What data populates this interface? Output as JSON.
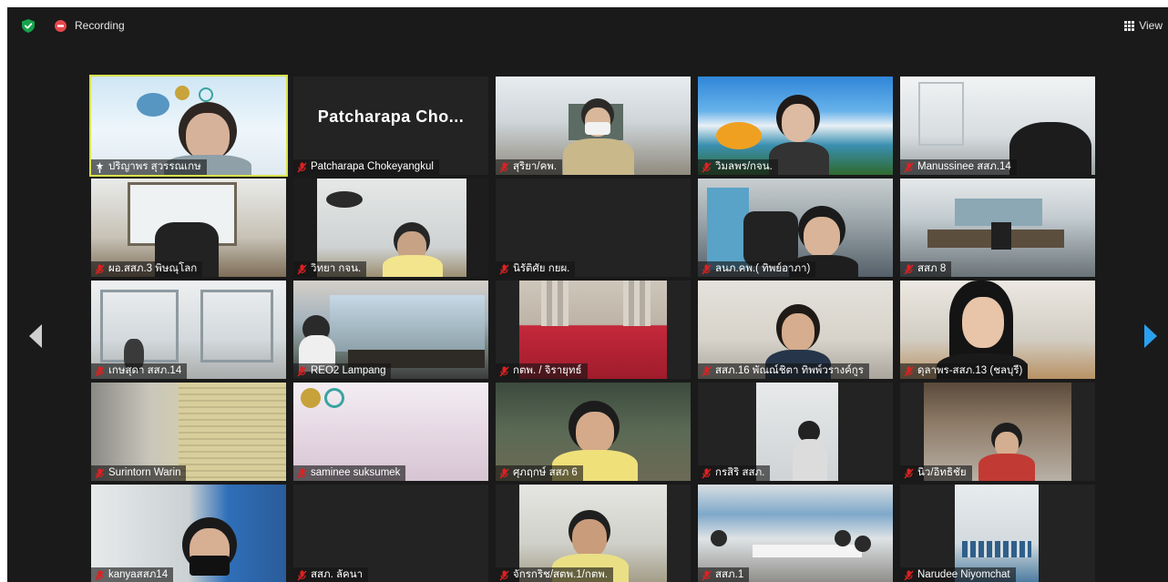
{
  "recording": {
    "label": "Recording"
  },
  "view": {
    "label": "View"
  },
  "gallery": {
    "big_name": "Patcharapa  Cho...",
    "tiles": [
      {
        "name": "ปริญาพร สุวรรณเกษ",
        "muted": false,
        "active": true
      },
      {
        "name": "Patcharapa Chokeyangkul",
        "muted": true
      },
      {
        "name": "สุริยา/คพ.",
        "muted": true
      },
      {
        "name": "วิมลพร/กจน.",
        "muted": true
      },
      {
        "name": "Manussinee สสภ.14",
        "muted": true
      },
      {
        "name": "ผอ.สสภ.3 พิษณุโลก",
        "muted": true
      },
      {
        "name": "วิทยา กจน.",
        "muted": true
      },
      {
        "name": "นิรัติศัย กยผ.",
        "muted": true
      },
      {
        "name": "ลนภ.คพ.( ทิพย์อาภา)",
        "muted": true
      },
      {
        "name": "สสภ 8",
        "muted": true
      },
      {
        "name": "เกษสุดา สสภ.14",
        "muted": true
      },
      {
        "name": "REO2 Lampang",
        "muted": true
      },
      {
        "name": "กตพ. / จิรายุทธ์",
        "muted": true
      },
      {
        "name": "สสภ.16 พัณณ์ชิตา ทิพพ์วรางค์กูร",
        "muted": true
      },
      {
        "name": "ดุลาพร-สสภ.13 (ชลบุรี)",
        "muted": true
      },
      {
        "name": "Surintorn Warin",
        "muted": true
      },
      {
        "name": "saminee suksumek",
        "muted": true
      },
      {
        "name": "ศุภฤกษ์ สสภ 6",
        "muted": true
      },
      {
        "name": "กรสิริ สสภ.",
        "muted": true
      },
      {
        "name": "นิว/อิทธิชัย",
        "muted": true
      },
      {
        "name": "kanyaสสภ14",
        "muted": true
      },
      {
        "name": "สสภ. ลัคนา",
        "muted": true
      },
      {
        "name": "จักรกริช/สตพ.1/กตพ.",
        "muted": true
      },
      {
        "name": "สสภ.1",
        "muted": true
      },
      {
        "name": "Narudee Niyomchat",
        "muted": true
      }
    ]
  },
  "colors": {
    "shield": "#16a34a",
    "recording": "#e5484d",
    "mic_off": "#e02020",
    "active_border": "#d9e24a",
    "next_arrow": "#2aa0f0",
    "prev_arrow": "#cfcfcf"
  }
}
